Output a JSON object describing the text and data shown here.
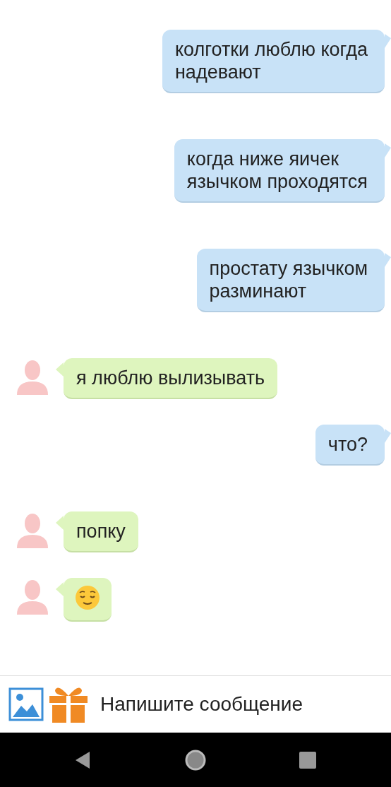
{
  "messages": [
    {
      "outgoing": true,
      "kind": "text",
      "text": "колготки люблю когда\nнадевают"
    },
    {
      "outgoing": true,
      "kind": "text",
      "text": "когда ниже яичек\nязычком проходятся"
    },
    {
      "outgoing": true,
      "kind": "text",
      "text": "простату язычком\nразминают"
    },
    {
      "outgoing": false,
      "kind": "text",
      "text": "я люблю вылизывать"
    },
    {
      "outgoing": true,
      "kind": "text",
      "text": "что?"
    },
    {
      "outgoing": false,
      "kind": "text",
      "text": "попку"
    },
    {
      "outgoing": false,
      "kind": "emoji"
    }
  ],
  "composer": {
    "placeholder": "Напишите сообщение"
  }
}
